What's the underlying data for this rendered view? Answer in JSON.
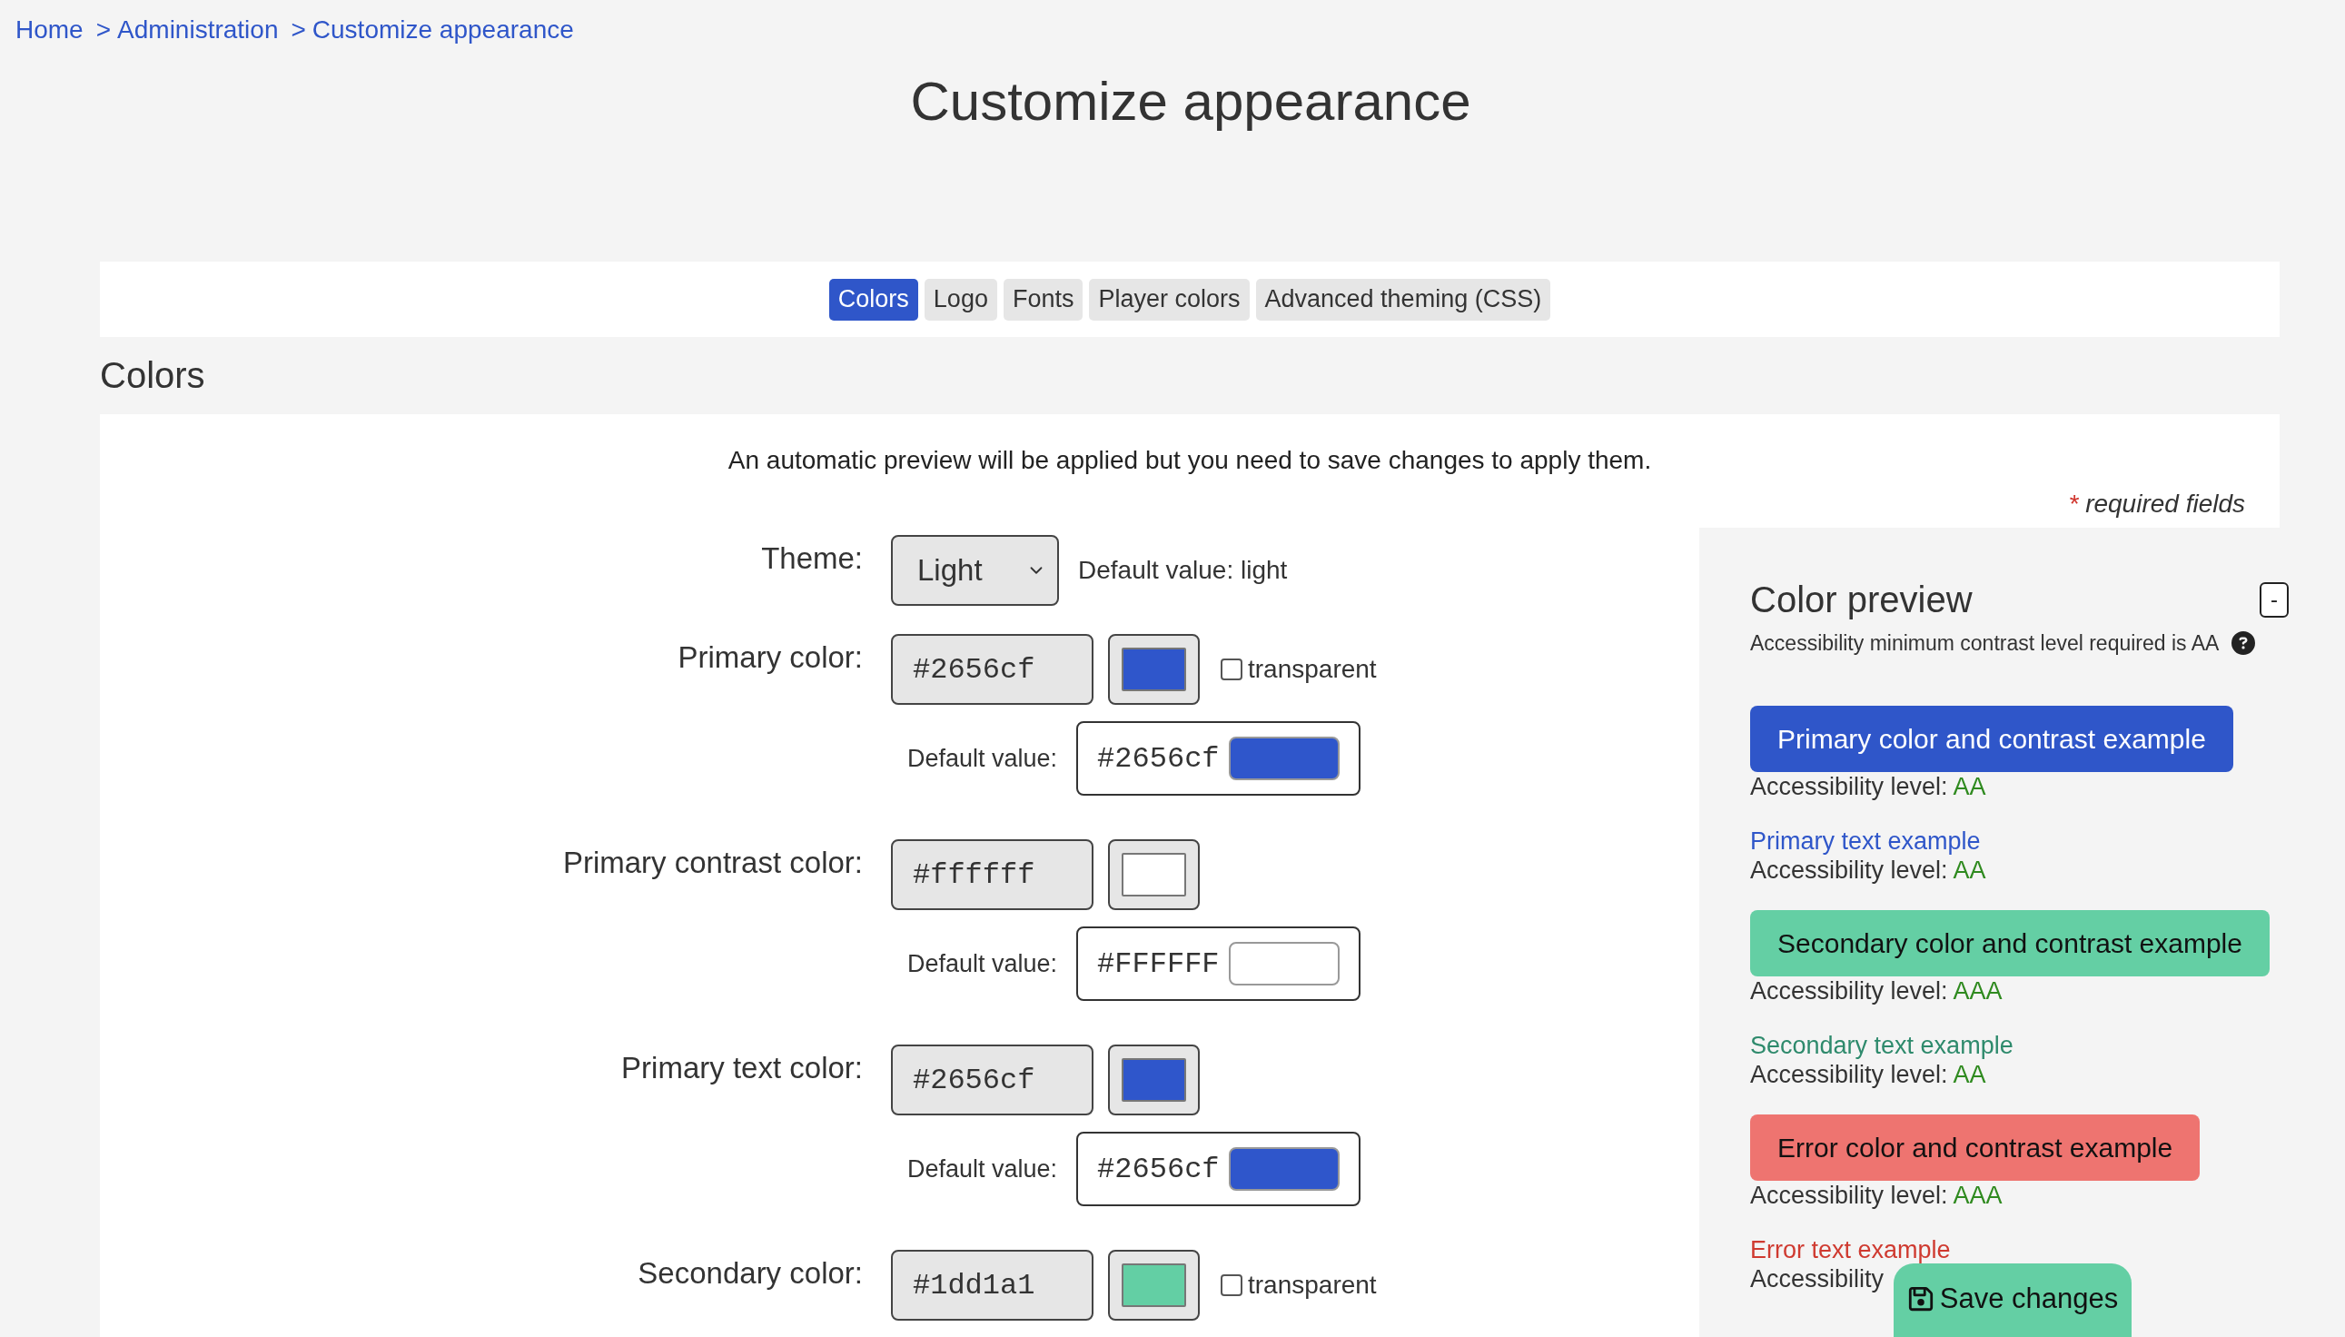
{
  "breadcrumb": [
    {
      "label": "Home"
    },
    {
      "separator": ">",
      "label": "Administration"
    },
    {
      "separator": ">",
      "label": "Customize appearance"
    }
  ],
  "page_title": "Customize appearance",
  "tabs": [
    {
      "label": "Colors",
      "selected": true
    },
    {
      "label": "Logo",
      "selected": false
    },
    {
      "label": "Fonts",
      "selected": false
    },
    {
      "label": "Player colors",
      "selected": false
    },
    {
      "label": "Advanced theming (CSS)",
      "selected": false
    }
  ],
  "section_title": "Colors",
  "notice": "An automatic preview will be applied but you need to save changes to apply them.",
  "required_note": {
    "marker": "*",
    "text": "required fields"
  },
  "fields": [
    {
      "kind": "select",
      "label": "Theme:",
      "value": "Light",
      "default_text": "Default value: light"
    },
    {
      "kind": "color",
      "label": "Primary color:",
      "value": "#2656cf",
      "color": "#2f56cb",
      "transparent_option": {
        "label": "transparent",
        "checked": false
      },
      "default": {
        "label": "Default value:",
        "value": "#2656cf",
        "color": "#2f56cb"
      }
    },
    {
      "kind": "color",
      "label": "Primary contrast color:",
      "value": "#ffffff",
      "color": "#ffffff",
      "default": {
        "label": "Default value:",
        "value": "#FFFFFF",
        "color": "#ffffff"
      }
    },
    {
      "kind": "color",
      "label": "Primary text color:",
      "value": "#2656cf",
      "color": "#2f56cb",
      "default": {
        "label": "Default value:",
        "value": "#2656cf",
        "color": "#2f56cb"
      }
    },
    {
      "kind": "color",
      "label": "Secondary color:",
      "value": "#1dd1a1",
      "color": "#63cfa4",
      "transparent_option": {
        "label": "transparent",
        "checked": false
      }
    }
  ],
  "preview": {
    "title": "Color preview",
    "collapse_button": "-",
    "subtitle": "Accessibility minimum contrast level required is AA",
    "examples": [
      {
        "kind": "button",
        "label": "Primary color and contrast example",
        "color": "#2f56c9",
        "rating_label": "Accessibility level:",
        "rating": "AA"
      },
      {
        "kind": "text",
        "label": "Primary text example",
        "color": "#2f56c9",
        "rating_label": "Accessibility level:",
        "rating": "AA"
      },
      {
        "kind": "button",
        "label": "Secondary color and contrast example",
        "color": "#64cfa4",
        "rating_label": "Accessibility level:",
        "rating": "AAA"
      },
      {
        "kind": "text",
        "label": "Secondary text example",
        "color": "#2e8a6c",
        "rating_label": "Accessibility level:",
        "rating": "AA"
      },
      {
        "kind": "button",
        "label": "Error color and contrast example",
        "color": "#ee7470",
        "rating_label": "Accessibility level:",
        "rating": "AAA"
      },
      {
        "kind": "text",
        "label": "Error text example",
        "color": "#cf3a30",
        "rating_label": "Accessibility"
      }
    ]
  },
  "save_button": "Save changes"
}
